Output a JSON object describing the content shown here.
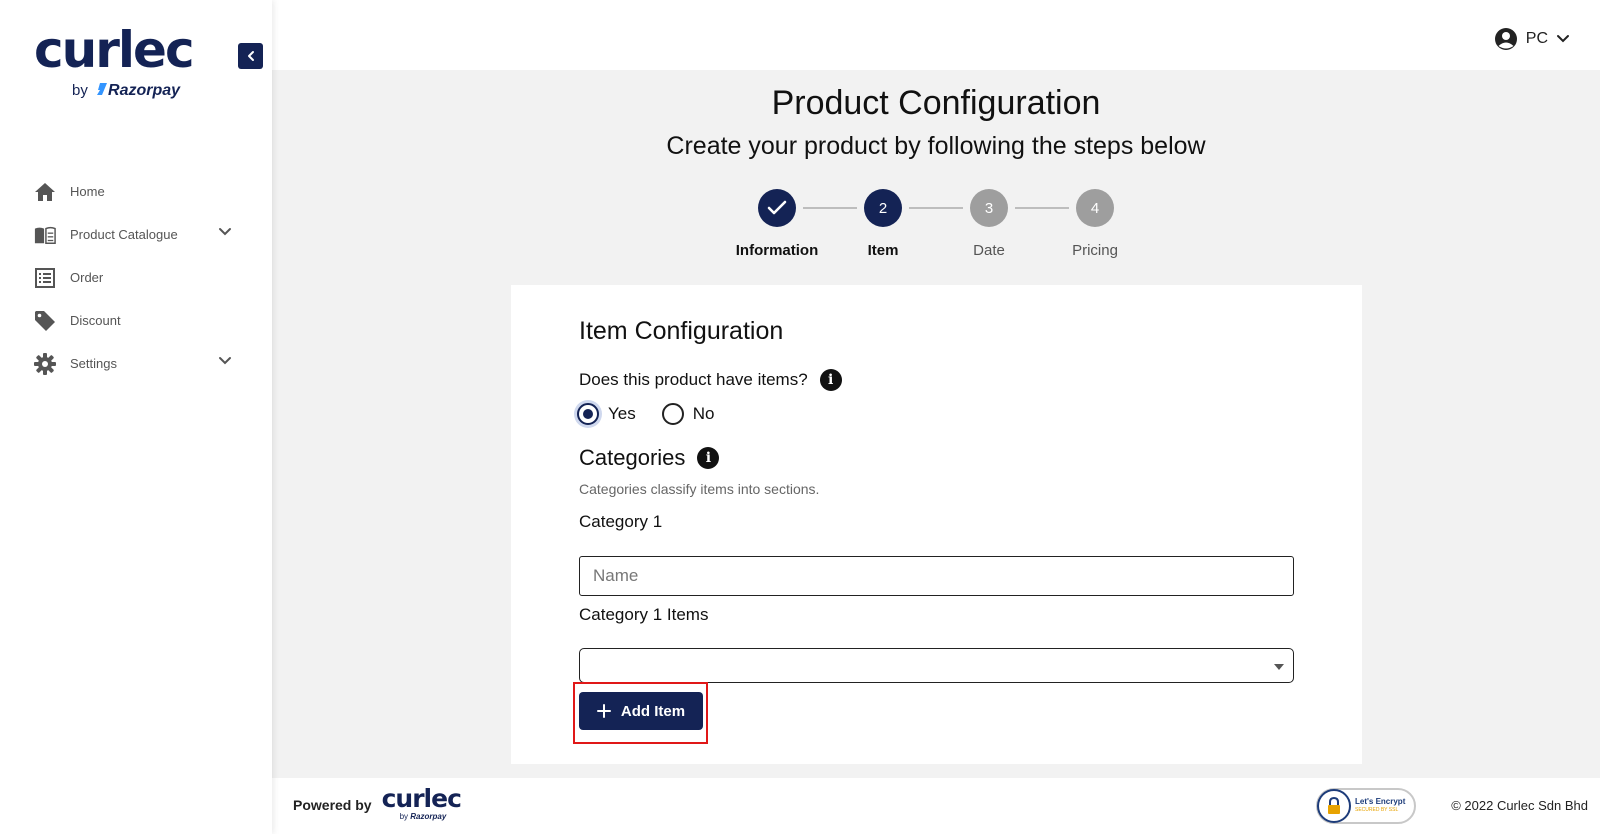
{
  "brand": {
    "logo_text": "curlec",
    "by_text": "by",
    "razorpay_text": "Razorpay"
  },
  "sidebar": {
    "items": [
      {
        "label": "Home",
        "icon": "home-icon"
      },
      {
        "label": "Product Catalogue",
        "icon": "book-icon",
        "has_dropdown": true
      },
      {
        "label": "Order",
        "icon": "list-icon"
      },
      {
        "label": "Discount",
        "icon": "tag-icon"
      },
      {
        "label": "Settings",
        "icon": "gear-icon",
        "has_dropdown": true
      }
    ]
  },
  "header": {
    "user_initials": "PC"
  },
  "page": {
    "title": "Product Configuration",
    "subtitle": "Create your product by following the steps below"
  },
  "stepper": {
    "steps": [
      {
        "number": "",
        "label": "Information",
        "state": "completed"
      },
      {
        "number": "2",
        "label": "Item",
        "state": "current"
      },
      {
        "number": "3",
        "label": "Date",
        "state": "upcoming"
      },
      {
        "number": "4",
        "label": "Pricing",
        "state": "upcoming"
      }
    ]
  },
  "form": {
    "title": "Item Configuration",
    "question": "Does this product have items?",
    "options": [
      {
        "label": "Yes",
        "checked": true
      },
      {
        "label": "No",
        "checked": false
      }
    ],
    "categories_title": "Categories",
    "categories_desc": "Categories classify items into sections.",
    "category_label": "Category 1",
    "name_placeholder": "Name",
    "name_value": "",
    "items_label": "Category 1 Items",
    "items_selected": "",
    "add_item_label": "Add Item"
  },
  "footer": {
    "powered_by": "Powered by",
    "logo_text": "curlec",
    "by_text": "by",
    "razorpay_text": "Razorpay",
    "ssl_line1": "Let's Encrypt",
    "ssl_line2": "SECURED BY SSL",
    "copyright": "© 2022 Curlec Sdn Bhd"
  },
  "colors": {
    "brand_navy": "#142355",
    "step_inactive": "#9e9e9e",
    "highlight_red": "#e01818",
    "background": "#f2f2f2"
  }
}
